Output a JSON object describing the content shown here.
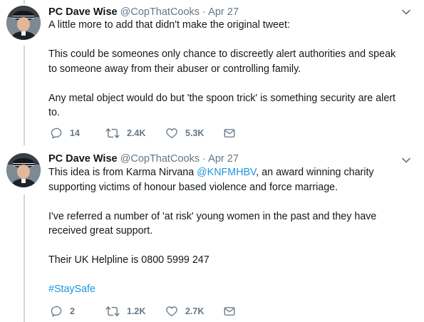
{
  "tweets": [
    {
      "name": "PC Dave Wise",
      "handle": "@CopThatCooks",
      "separator": "·",
      "date": "Apr 27",
      "paragraphs": [
        "A little more to add that didn't make the original tweet:",
        "This could be someones only chance to discreetly alert authorities and speak to someone away from their abuser or controlling family.",
        "Any metal object would do but 'the spoon trick' is something security are alert to."
      ],
      "replies": "14",
      "retweets": "2.4K",
      "likes": "5.3K"
    },
    {
      "name": "PC Dave Wise",
      "handle": "@CopThatCooks",
      "separator": "·",
      "date": "Apr 27",
      "p1_before": "This idea is from Karma Nirvana ",
      "p1_mention": "@KNFMHBV",
      "p1_after": ", an award winning charity supporting victims of honour based violence and force marriage.",
      "p2": "I've referred a number of 'at risk' young women in the past and they have received great support.",
      "p3": "Their UK Helpline is 0800 5999 247",
      "hashtag": "#StaySafe",
      "replies": "2",
      "retweets": "1.2K",
      "likes": "2.7K"
    }
  ],
  "icons": {
    "reply": "reply-icon",
    "retweet": "retweet-icon",
    "like": "heart-icon",
    "dm": "envelope-icon",
    "more": "chevron-down-icon"
  },
  "colors": {
    "link": "#1b95e0",
    "muted": "#657786",
    "thread": "#ccd6dd"
  }
}
